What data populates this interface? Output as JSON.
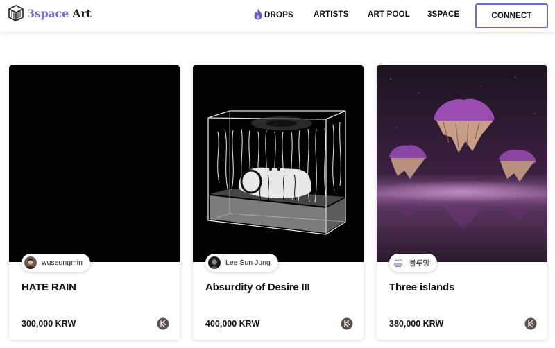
{
  "brand": {
    "prefix": "3space",
    "suffix": "Art",
    "logo_icon": "isometric-cube-icon"
  },
  "nav": {
    "items": [
      {
        "label": "DROPS",
        "icon": "flame-icon",
        "icon_color": "#6f5bd8"
      },
      {
        "label": "ARTISTS"
      },
      {
        "label": "ART POOL"
      },
      {
        "label": "3SPACE"
      }
    ],
    "connect_label": "CONNECT",
    "accent_color": "#6f67dc"
  },
  "cards": [
    {
      "artist": "wuseungmin",
      "title": "HATE RAIN",
      "price": "300,000 KRW",
      "currency_icon": "klay-icon"
    },
    {
      "artist": "Lee Sun Jung",
      "title": "Absurdity of Desire III",
      "price": "400,000 KRW",
      "currency_icon": "klay-icon"
    },
    {
      "artist": "블루밍",
      "title": "Three islands",
      "price": "380,000 KRW",
      "currency_icon": "klay-icon"
    }
  ]
}
